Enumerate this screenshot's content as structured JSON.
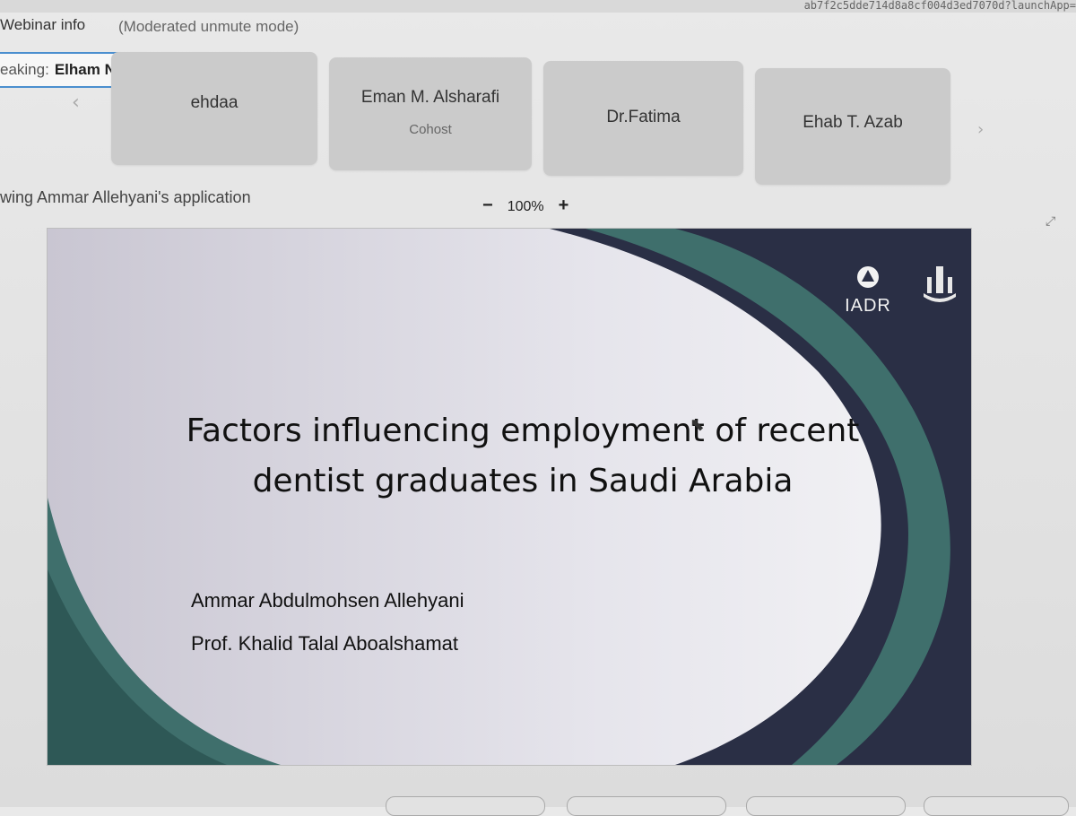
{
  "browser": {
    "url_fragment": "ab7f2c5dde714d8a8cf004d3ed7070d?launchApp="
  },
  "header": {
    "webinar_info": "Webinar info",
    "mode": "(Moderated unmute mode)"
  },
  "speaking": {
    "label": "eaking:",
    "name": "Elham N. Alsahafi"
  },
  "participants": [
    {
      "name": "ehdaa",
      "role": ""
    },
    {
      "name": "Eman M. Alsharafi",
      "role": "Cohost"
    },
    {
      "name": "Dr.Fatima",
      "role": ""
    },
    {
      "name": "Ehab T. Azab",
      "role": ""
    }
  ],
  "nav": {
    "prev_icon": "chevron-left-icon",
    "next_icon": "chevron-right-icon"
  },
  "share": {
    "viewing": "wing Ammar Allehyani's application",
    "zoom_minus": "−",
    "zoom_value": "100%",
    "zoom_plus": "+"
  },
  "slide": {
    "title_line1": "Factors influencing employment of recent",
    "title_line2": "dentist graduates in Saudi Arabia",
    "author1": "Ammar Abdulmohsen Allehyani",
    "author2": "Prof. Khalid Talal Aboalshamat",
    "logo_text": "IADR",
    "colors": {
      "teal": "#3f6f6c",
      "navy": "#2a2f45",
      "background": "#eeeef2"
    }
  },
  "colors": {
    "highlight_border": "#4b8fcf",
    "tile_bg": "#cbcbcb"
  }
}
